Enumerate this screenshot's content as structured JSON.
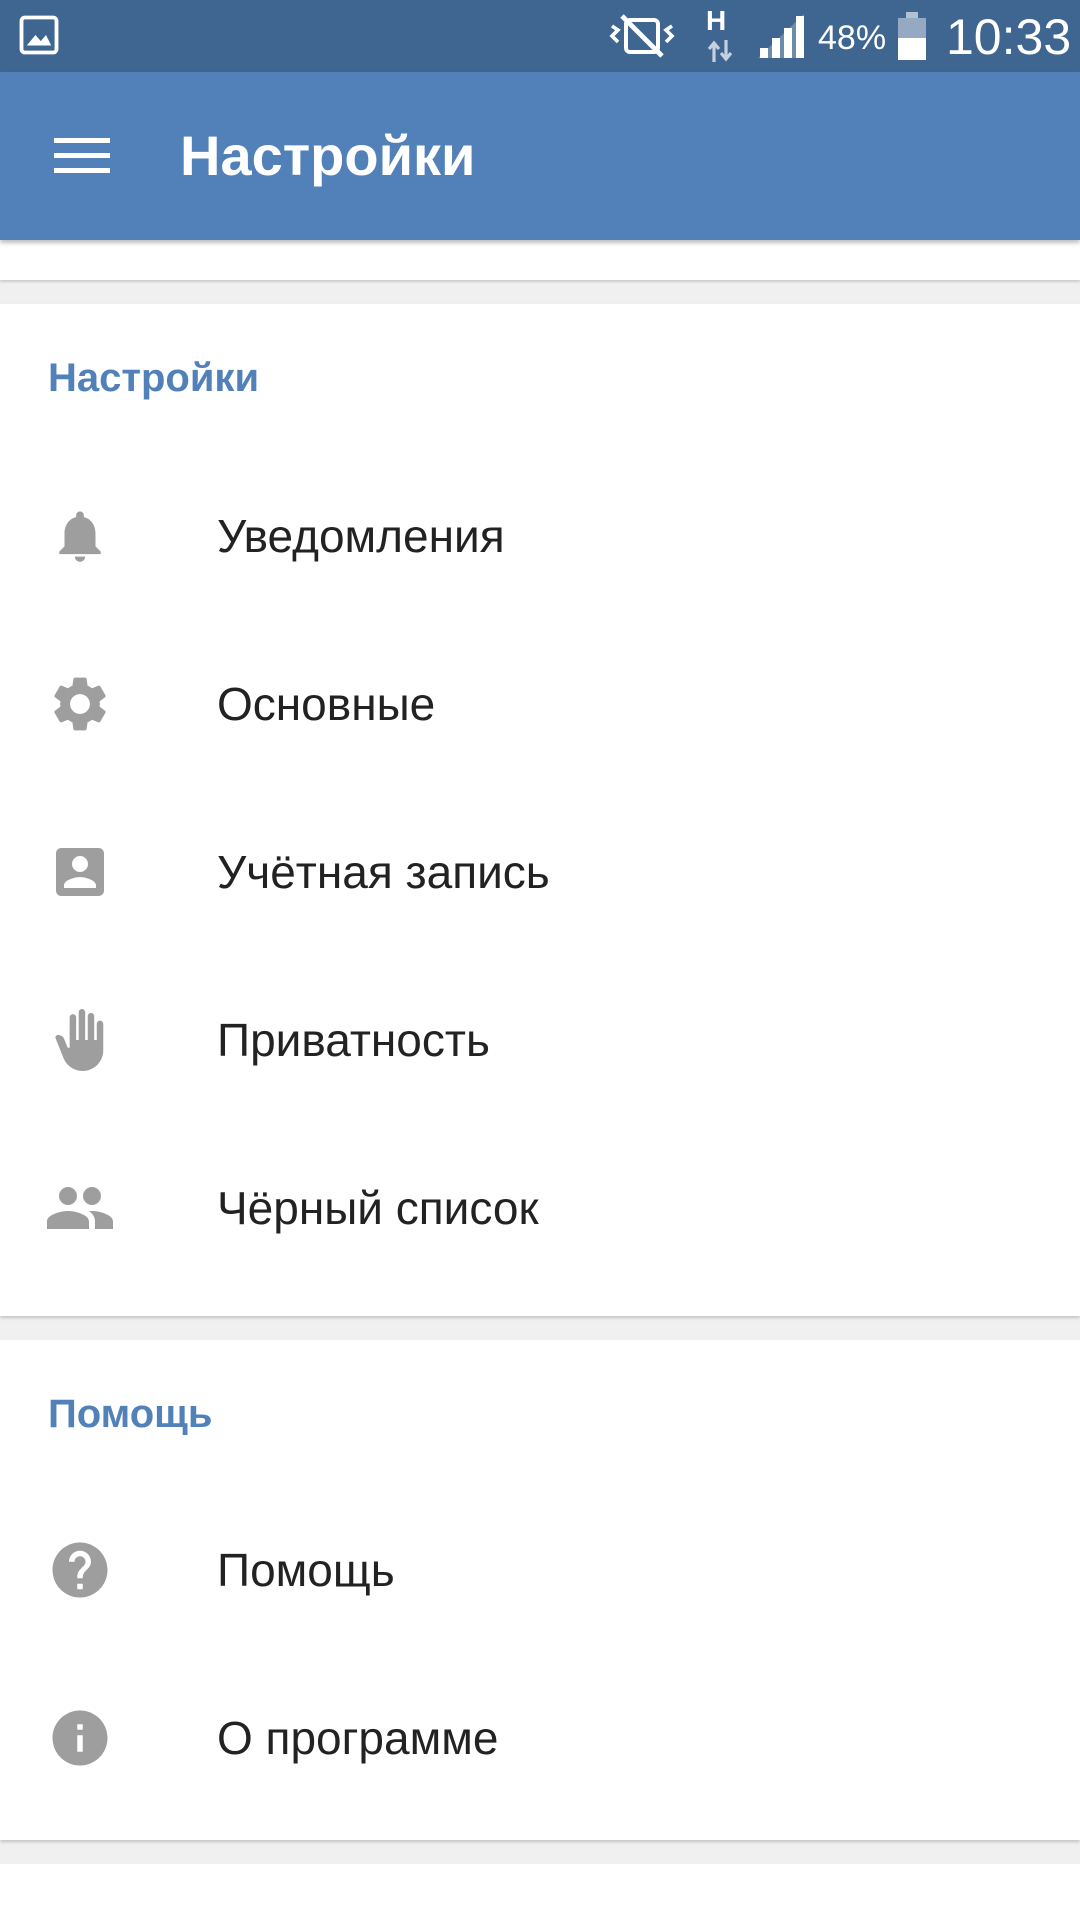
{
  "status_bar": {
    "battery_percent": "48%",
    "time": "10:33",
    "network_type": "H"
  },
  "app_bar": {
    "title": "Настройки"
  },
  "sections": [
    {
      "header": "Настройки",
      "items": [
        {
          "label": "Уведомления",
          "icon": "bell-icon"
        },
        {
          "label": "Основные",
          "icon": "gear-icon"
        },
        {
          "label": "Учётная запись",
          "icon": "account-box-icon"
        },
        {
          "label": "Приватность",
          "icon": "hand-icon"
        },
        {
          "label": "Чёрный список",
          "icon": "people-icon"
        }
      ]
    },
    {
      "header": "Помощь",
      "items": [
        {
          "label": "Помощь",
          "icon": "help-circle-icon"
        },
        {
          "label": "О программе",
          "icon": "info-icon"
        }
      ]
    }
  ],
  "colors": {
    "status_bar": "#3f6591",
    "app_bar": "#5181b8",
    "accent": "#5181b8",
    "icon_gray": "#9e9e9e",
    "text": "#222222"
  }
}
